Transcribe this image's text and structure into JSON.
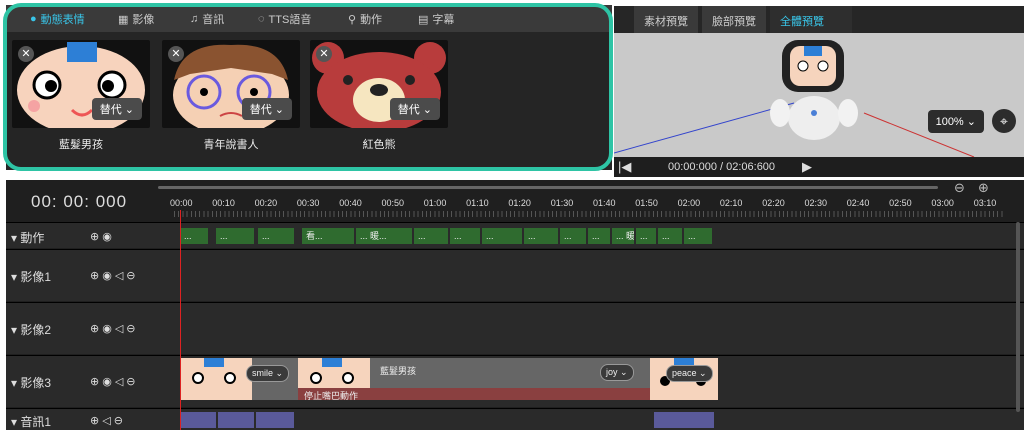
{
  "asset_tabs": [
    {
      "label": "動態表情",
      "icon": "person-icon",
      "active": true
    },
    {
      "label": "影像",
      "icon": "film-icon",
      "active": false
    },
    {
      "label": "音訊",
      "icon": "music-icon",
      "active": false
    },
    {
      "label": "TTS語音",
      "icon": "speech-bubble-icon",
      "active": false
    },
    {
      "label": "動作",
      "icon": "running-person-icon",
      "active": false
    },
    {
      "label": "字幕",
      "icon": "subtitle-icon",
      "active": false
    }
  ],
  "assets": [
    {
      "name": "藍髮男孩",
      "sub": "替代"
    },
    {
      "name": "青年說書人",
      "sub": "替代"
    },
    {
      "name": "紅色熊",
      "sub": "替代"
    }
  ],
  "preview_tabs": [
    {
      "label": "素材預覽",
      "active": false
    },
    {
      "label": "臉部預覽",
      "active": false
    },
    {
      "label": "全體預覽",
      "active": true
    }
  ],
  "preview": {
    "zoom": "100%",
    "time": "00:00:000 / 02:06:600"
  },
  "timeline": {
    "timecode": "00: 00: 000",
    "ticks": [
      "00:00",
      "00:10",
      "00:20",
      "00:30",
      "00:40",
      "00:50",
      "01:00",
      "01:10",
      "01:20",
      "01:30",
      "01:40",
      "01:50",
      "02:00",
      "02:10",
      "02:20",
      "02:30",
      "02:40",
      "02:50",
      "03:00",
      "03:10"
    ],
    "tracks": {
      "motion": "動作",
      "video1": "影像1",
      "video2": "影像2",
      "video3": "影像3",
      "audio1": "音訊1"
    },
    "motion_clips": [
      "...",
      "...",
      "...",
      "看...",
      "... 暖...",
      "...",
      "...",
      "...",
      "...",
      "...",
      "...",
      "... 暖...",
      "...",
      "...",
      "...",
      "...",
      "...",
      "...",
      "..."
    ],
    "face_clips": [
      {
        "style": "smile",
        "name": ""
      },
      {
        "style": "joy",
        "name": "藍髮男孩",
        "sub": "停止嘴巴動作"
      },
      {
        "style": "peace",
        "name": ""
      }
    ]
  },
  "colors": {
    "accent": "#39c5e8",
    "highlight": "#2ec4a5",
    "motion_clip": "#2f6b2f",
    "audio_clip": "#5a5a9a",
    "playhead": "#d22"
  }
}
